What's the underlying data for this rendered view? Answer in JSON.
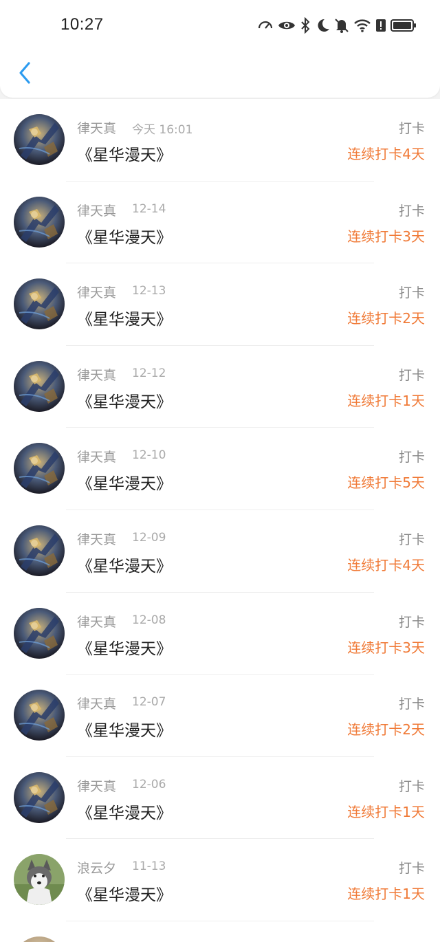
{
  "status_bar": {
    "time": "10:27",
    "icons": [
      "speedometer-icon",
      "eye-icon",
      "bluetooth-icon",
      "moon-icon",
      "bell-off-icon",
      "wifi-icon",
      "alert-icon",
      "battery-icon"
    ]
  },
  "header": {
    "back_icon": "chevron-left-icon",
    "accent_color": "#2d9cf0"
  },
  "colors": {
    "streak": "#f07a37",
    "title": "#222222",
    "meta": "#999999"
  },
  "list": {
    "items": [
      {
        "user": "律天真",
        "time": "今天 16:01",
        "title": "《星华漫天》",
        "type": "打卡",
        "streak": "连续打卡4天",
        "avatar": "warrior"
      },
      {
        "user": "律天真",
        "time": "12-14",
        "title": "《星华漫天》",
        "type": "打卡",
        "streak": "连续打卡3天",
        "avatar": "warrior"
      },
      {
        "user": "律天真",
        "time": "12-13",
        "title": "《星华漫天》",
        "type": "打卡",
        "streak": "连续打卡2天",
        "avatar": "warrior"
      },
      {
        "user": "律天真",
        "time": "12-12",
        "title": "《星华漫天》",
        "type": "打卡",
        "streak": "连续打卡1天",
        "avatar": "warrior"
      },
      {
        "user": "律天真",
        "time": "12-10",
        "title": "《星华漫天》",
        "type": "打卡",
        "streak": "连续打卡5天",
        "avatar": "warrior"
      },
      {
        "user": "律天真",
        "time": "12-09",
        "title": "《星华漫天》",
        "type": "打卡",
        "streak": "连续打卡4天",
        "avatar": "warrior"
      },
      {
        "user": "律天真",
        "time": "12-08",
        "title": "《星华漫天》",
        "type": "打卡",
        "streak": "连续打卡3天",
        "avatar": "warrior"
      },
      {
        "user": "律天真",
        "time": "12-07",
        "title": "《星华漫天》",
        "type": "打卡",
        "streak": "连续打卡2天",
        "avatar": "warrior"
      },
      {
        "user": "律天真",
        "time": "12-06",
        "title": "《星华漫天》",
        "type": "打卡",
        "streak": "连续打卡1天",
        "avatar": "warrior"
      },
      {
        "user": "浪云夕",
        "time": "11-13",
        "title": "《星华漫天》",
        "type": "打卡",
        "streak": "连续打卡1天",
        "avatar": "husky"
      }
    ]
  }
}
